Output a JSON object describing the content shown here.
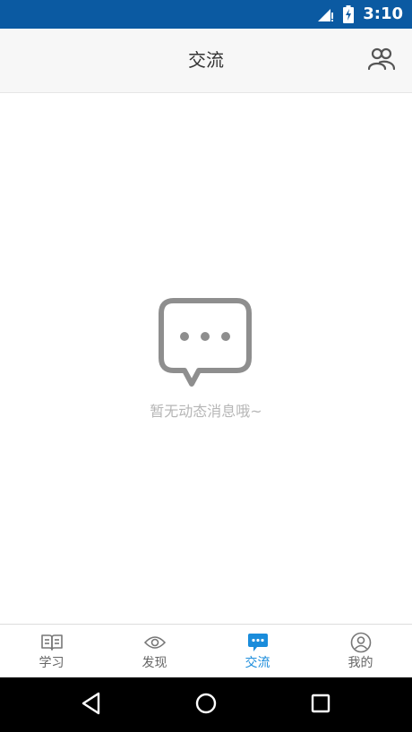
{
  "status_bar": {
    "time": "3:10",
    "background": "#0b5aa2"
  },
  "header": {
    "title": "交流",
    "action_icon": "group-icon"
  },
  "empty_state": {
    "icon": "chat-bubble-dots-icon",
    "message": "暂无动态消息哦~"
  },
  "tabbar": {
    "active_color": "#1a8cdb",
    "items": [
      {
        "label": "学习",
        "icon": "book-icon"
      },
      {
        "label": "发现",
        "icon": "eye-icon"
      },
      {
        "label": "交流",
        "icon": "chat-icon",
        "active": true
      },
      {
        "label": "我的",
        "icon": "user-icon"
      }
    ]
  },
  "navbar": {
    "buttons": [
      "back-icon",
      "home-icon",
      "recents-icon"
    ]
  }
}
